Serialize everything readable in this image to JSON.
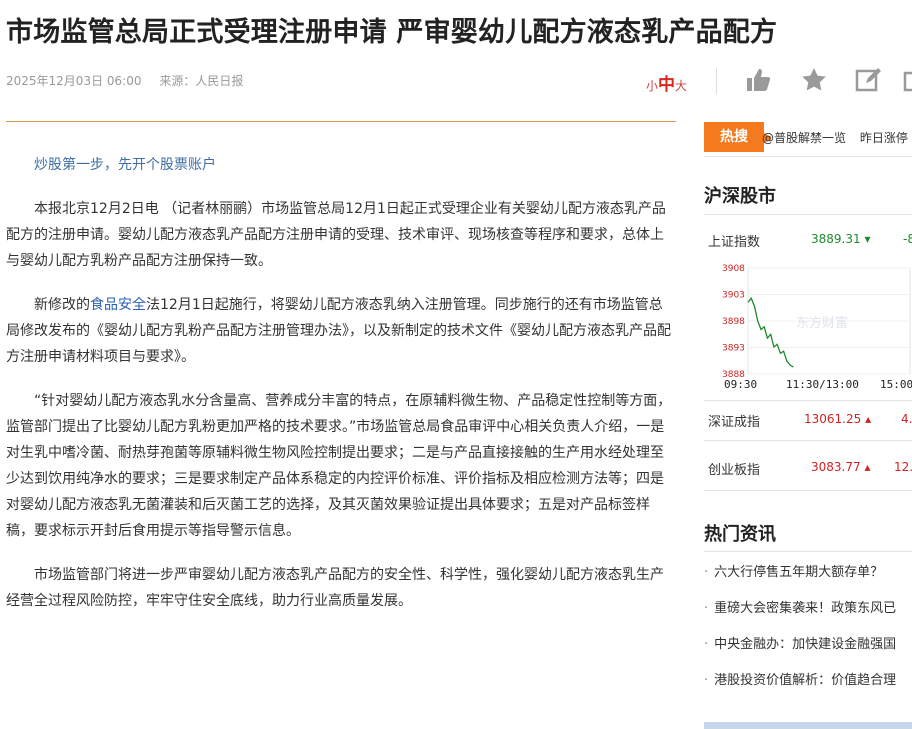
{
  "headline": "市场监管总局正式受理注册申请 严审婴幼儿配方液态乳产品配方",
  "meta": {
    "date": "2025年12月03日 06:00",
    "source": "来源：人民日报"
  },
  "font_size": {
    "small": "小",
    "mid": "中",
    "large": "大"
  },
  "actions": [
    "thumbs-up-icon",
    "star-icon",
    "edit-icon",
    "share-icon"
  ],
  "promo_link": "炒股第一步，先开个股票账户",
  "article": {
    "p1": "本报北京12月2日电 （记者林丽鹂）市场监管总局12月1日起正式受理企业有关婴幼儿配方液态乳产品配方的注册申请。婴幼儿配方液态乳产品配方注册申请的受理、技术审评、现场核查等程序和要求，总体上与婴幼儿配方乳粉产品配方注册保持一致。",
    "p2_pre": "新修改的",
    "p2_kw": "食品安全",
    "p2_post": "法12月1日起施行，将婴幼儿配方液态乳纳入注册管理。同步施行的还有市场监管总局修改发布的《婴幼儿配方乳粉产品配方注册管理办法》，以及新制定的技术文件《婴幼儿配方液态乳产品配方注册申请材料项目与要求》。",
    "p3": "“针对婴幼儿配方液态乳水分含量高、营养成分丰富的特点，在原辅料微生物、产品稳定性控制等方面，监管部门提出了比婴幼儿配方乳粉更加严格的技术要求。”市场监管总局食品审评中心相关负责人介绍，一是对生乳中嗜冷菌、耐热芽孢菌等原辅料微生物风险控制提出要求；二是与产品直接接触的生产用水经处理至少达到饮用纯净水的要求；三是要求制定产品体系稳定的内控评价标准、评价指标及相应检测方法等；四是对婴幼儿配方液态乳无菌灌装和后灭菌工艺的选择，及其灭菌效果验证提出具体要求；五是对产品标签样稿，要求标示开封后食用提示等指导警示信息。",
    "p4": "市场监管部门将进一步严审婴幼儿配方液态乳产品配方的安全性、科学性，强化婴幼儿配方液态乳生产经营全过程风险防控，牢牢守住安全底线，助力行业高质量发展。"
  },
  "hot": {
    "label": "热搜",
    "items": [
      "@普股解禁一览",
      "昨日涨停",
      "坚"
    ]
  },
  "market": {
    "title": "沪深股市",
    "indices": [
      {
        "name": "上证指数",
        "value": "3889.31",
        "trend": "down",
        "change": "-8"
      },
      {
        "name": "深证成指",
        "value": "13061.25",
        "trend": "up",
        "change": "4."
      },
      {
        "name": "创业板指",
        "value": "3083.77",
        "trend": "up",
        "change": "12."
      }
    ],
    "chart_data": {
      "type": "line",
      "y_ticks": [
        "3908",
        "3903",
        "3898",
        "3893",
        "3888"
      ],
      "x_ticks": [
        "09:30",
        "11:30/13:00",
        "15:00"
      ],
      "ylim": [
        3888,
        3908
      ],
      "watermark": "东方财富",
      "x": [
        0,
        0.02,
        0.04,
        0.06,
        0.08,
        0.1,
        0.12,
        0.14,
        0.16,
        0.18,
        0.2,
        0.22,
        0.24,
        0.26,
        0.28
      ],
      "values": [
        3901.5,
        3902.3,
        3900.8,
        3898.0,
        3896.4,
        3896.9,
        3894.8,
        3895.5,
        3893.1,
        3893.6,
        3891.9,
        3892.3,
        3890.4,
        3889.7,
        3889.3
      ]
    }
  },
  "news": {
    "title": "热门资讯",
    "items": [
      "六大行停售五年期大额存单？",
      "重磅大会密集袭来！政策东风已",
      "中央金融办：加快建设金融强国",
      "港股投资价值解析：价值趋合理"
    ]
  }
}
